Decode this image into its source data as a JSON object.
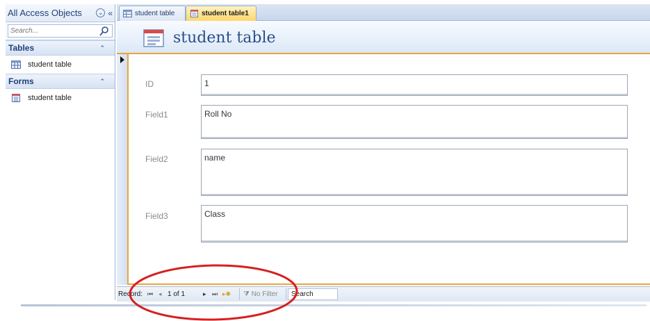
{
  "nav_pane": {
    "title": "All Access Objects",
    "search_placeholder": "Search...",
    "groups": [
      {
        "label": "Tables",
        "items": [
          {
            "label": "student table",
            "icon": "table-icon"
          }
        ]
      },
      {
        "label": "Forms",
        "items": [
          {
            "label": "student table",
            "icon": "form-icon"
          }
        ]
      }
    ]
  },
  "tabs": [
    {
      "label": "student table",
      "icon": "table-icon",
      "active": false
    },
    {
      "label": "student table1",
      "icon": "form-icon",
      "active": true
    }
  ],
  "form": {
    "title": "student table",
    "fields": [
      {
        "label": "ID",
        "value": "1"
      },
      {
        "label": "Field1",
        "value": "Roll No"
      },
      {
        "label": "Field2",
        "value": "name"
      },
      {
        "label": "Field3",
        "value": "Class"
      }
    ]
  },
  "record_nav": {
    "label": "Record:",
    "position": "1 of 1",
    "filter_label": "No Filter",
    "search_label": "Search"
  },
  "colors": {
    "accent": "#e9a43c",
    "annotation_circle": "#d61f1f",
    "header_text": "#2a4f8b"
  }
}
